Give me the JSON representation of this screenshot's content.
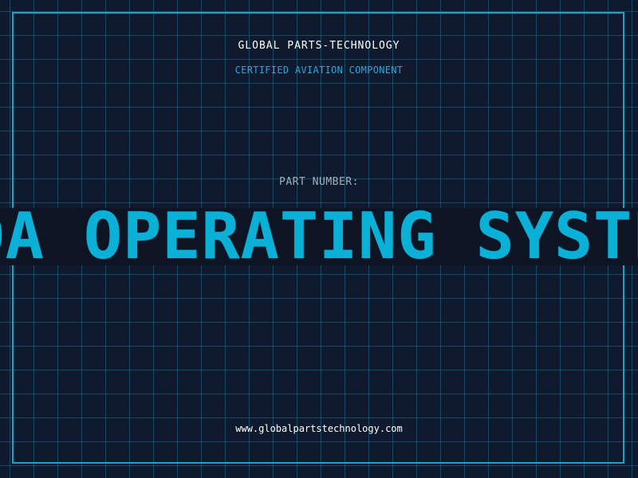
{
  "label": {
    "company": "GLOBAL PARTS-TECHNOLOGY",
    "subtitle": "CERTIFIED AVIATION COMPONENT",
    "part_number_label": "PART NUMBER:",
    "part_number": "ADA OPERATING SYSTEM",
    "website": "www.globalpartstechnology.com"
  },
  "colors": {
    "background": "#101a2e",
    "grid": "#1e6e8c",
    "accent": "#0ab0d6",
    "frame": "#1fa0c8"
  }
}
